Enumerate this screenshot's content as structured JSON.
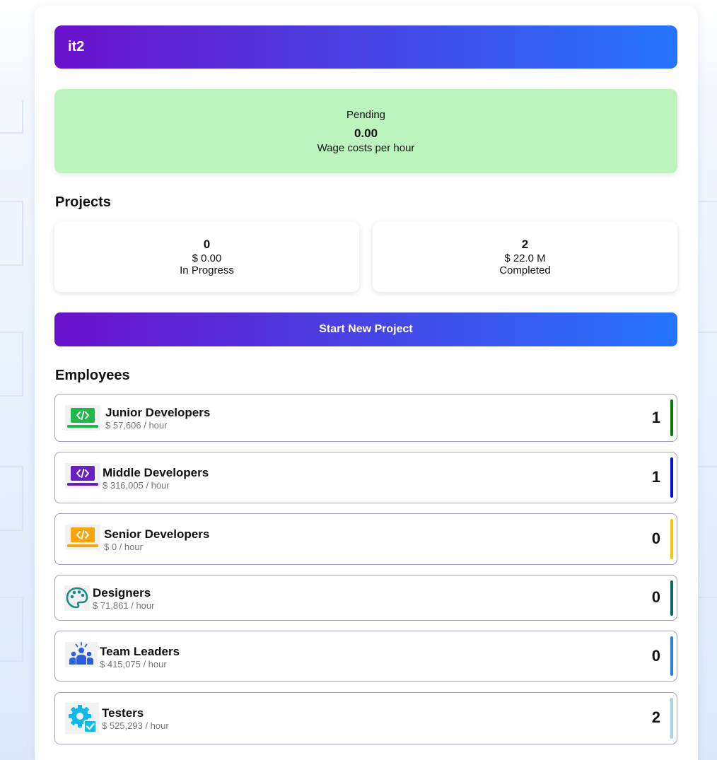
{
  "company": {
    "name": "it2"
  },
  "status": {
    "label": "Pending",
    "value": "0.00",
    "description": "Wage costs per hour",
    "color": "#bbf4bd"
  },
  "projects": {
    "title": "Projects",
    "items": [
      {
        "count": "0",
        "amount": "$ 0.00",
        "label": "In Progress"
      },
      {
        "count": "2",
        "amount": "$ 22.0 M",
        "label": "Completed"
      }
    ],
    "start_button_label": "Start New Project"
  },
  "employees": {
    "title": "Employees",
    "items": [
      {
        "name": "Junior Developers",
        "rate": "$ 57,606 / hour",
        "count": "1",
        "icon": "laptop-code-icon",
        "color": "#0a7a0a"
      },
      {
        "name": "Middle Developers",
        "rate": "$ 316,005 / hour",
        "count": "1",
        "icon": "laptop-code-icon",
        "color": "#0a10d8"
      },
      {
        "name": "Senior Developers",
        "rate": "$ 0 / hour",
        "count": "0",
        "icon": "laptop-code-icon",
        "color": "#f4c60a"
      },
      {
        "name": "Designers",
        "rate": "$ 71,861 / hour",
        "count": "0",
        "icon": "palette-icon",
        "color": "#0b6b64"
      },
      {
        "name": "Team Leaders",
        "rate": "$ 415,075 / hour",
        "count": "0",
        "icon": "team-icon",
        "color": "#2f7ee6"
      },
      {
        "name": "Testers",
        "rate": "$ 525,293 / hour",
        "count": "2",
        "icon": "gear-check-icon",
        "color": "#a8d4e8"
      }
    ]
  },
  "colors": {
    "gradient_start": "#6a11cb",
    "gradient_end": "#2575fc",
    "laptop_junior": "#1fb84a",
    "laptop_middle": "#6a1fc4",
    "laptop_senior": "#f5a50d",
    "designer_icon": "#1a8a83",
    "team_icon": "#2a5fe0",
    "tester_icon": "#0fb8e8"
  }
}
